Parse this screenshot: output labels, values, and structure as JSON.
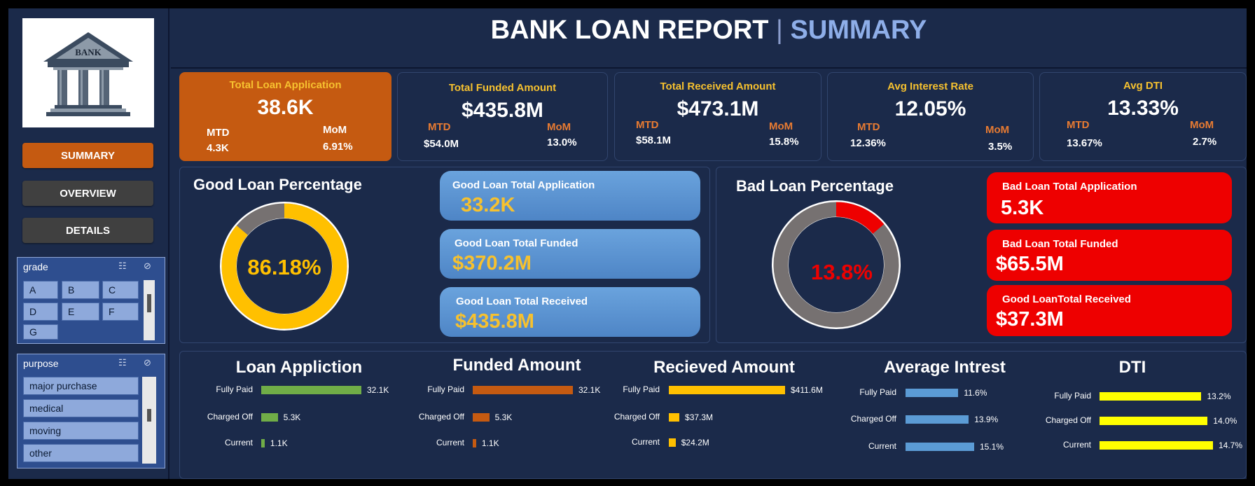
{
  "header": {
    "title": "BANK LOAN REPORT",
    "separator": "|",
    "subtitle": "SUMMARY"
  },
  "logo": {
    "text": "BANK"
  },
  "nav": [
    {
      "label": "SUMMARY",
      "color": "#c55a11"
    },
    {
      "label": "OVERVIEW",
      "color": "#404040"
    },
    {
      "label": "DETAILS",
      "color": "#404040"
    }
  ],
  "slicers": {
    "grade": {
      "title": "grade",
      "items": [
        "A",
        "B",
        "C",
        "D",
        "E",
        "F",
        "G"
      ]
    },
    "purpose": {
      "title": "purpose",
      "items": [
        "major purchase",
        "medical",
        "moving",
        "other"
      ]
    }
  },
  "kpis": [
    {
      "title": "Total Loan Application",
      "value": "38.6K",
      "mtd_label": "MTD",
      "mtd": "4.3K",
      "mom_label": "MoM",
      "mom": "6.91%"
    },
    {
      "title": "Total Funded Amount",
      "value": "$435.8M",
      "mtd_label": "MTD",
      "mtd": "$54.0M",
      "mom_label": "MoM",
      "mom": "13.0%"
    },
    {
      "title": "Total Received Amount",
      "value": "$473.1M",
      "mtd_label": "MTD",
      "mtd": "$58.1M",
      "mom_label": "MoM",
      "mom": "15.8%"
    },
    {
      "title": "Avg Interest Rate",
      "value": "12.05%",
      "mtd_label": "MTD",
      "mtd": "12.36%",
      "mom_label": "MoM",
      "mom": "3.5%"
    },
    {
      "title": "Avg DTI",
      "value": "13.33%",
      "mtd_label": "MTD",
      "mtd": "13.67%",
      "mom_label": "MoM",
      "mom": "2.7%"
    }
  ],
  "good": {
    "title": "Good Loan Percentage",
    "percent_label": "86.18%",
    "percent": 86.18,
    "cards": [
      {
        "title": "Good Loan Total Application",
        "value": "33.2K"
      },
      {
        "title": "Good Loan Total Funded",
        "value": "$370.2M"
      },
      {
        "title": "Good Loan Total Received",
        "value": "$435.8M"
      }
    ]
  },
  "bad": {
    "title": "Bad Loan Percentage",
    "percent_label": "13.8%",
    "percent": 13.8,
    "cards": [
      {
        "title": "Bad Loan Total Application",
        "value": "5.3K"
      },
      {
        "title": "Bad Loan Total Funded",
        "value": "$65.5M"
      },
      {
        "title": "Good LoanTotal Received",
        "value": "$37.3M"
      }
    ]
  },
  "colors": {
    "good": "#ffc000",
    "bad": "#ee0000",
    "donut_rest": "#767171",
    "app": "#70ad47",
    "funded": "#c55a11",
    "received": "#ffc000",
    "interest": "#5b9bd5",
    "dti": "#ffff00"
  },
  "chart_data": [
    {
      "type": "bar",
      "title": "Loan Appliction",
      "categories": [
        "Fully Paid",
        "Charged Off",
        "Current"
      ],
      "values": [
        32.1,
        5.3,
        1.1
      ],
      "labels": [
        "32.1K",
        "5.3K",
        "1.1K"
      ]
    },
    {
      "type": "bar",
      "title": "Funded Amount",
      "categories": [
        "Fully Paid",
        "Charged Off",
        "Current"
      ],
      "values": [
        32.1,
        5.3,
        1.1
      ],
      "labels": [
        "32.1K",
        "5.3K",
        "1.1K"
      ]
    },
    {
      "type": "bar",
      "title": "Recieved Amount",
      "categories": [
        "Fully Paid",
        "Charged Off",
        "Current"
      ],
      "values": [
        411.6,
        37.3,
        24.2
      ],
      "labels": [
        "$411.6M",
        "$37.3M",
        "$24.2M"
      ]
    },
    {
      "type": "bar",
      "title": "Average Intrest",
      "categories": [
        "Fully Paid",
        "Charged Off",
        "Current"
      ],
      "values": [
        11.6,
        13.9,
        15.1
      ],
      "labels": [
        "11.6%",
        "13.9%",
        "15.1%"
      ]
    },
    {
      "type": "bar",
      "title": "DTI",
      "categories": [
        "Fully Paid",
        "Charged Off",
        "Current"
      ],
      "values": [
        13.2,
        14.0,
        14.7
      ],
      "labels": [
        "13.2%",
        "14.0%",
        "14.7%"
      ]
    }
  ]
}
